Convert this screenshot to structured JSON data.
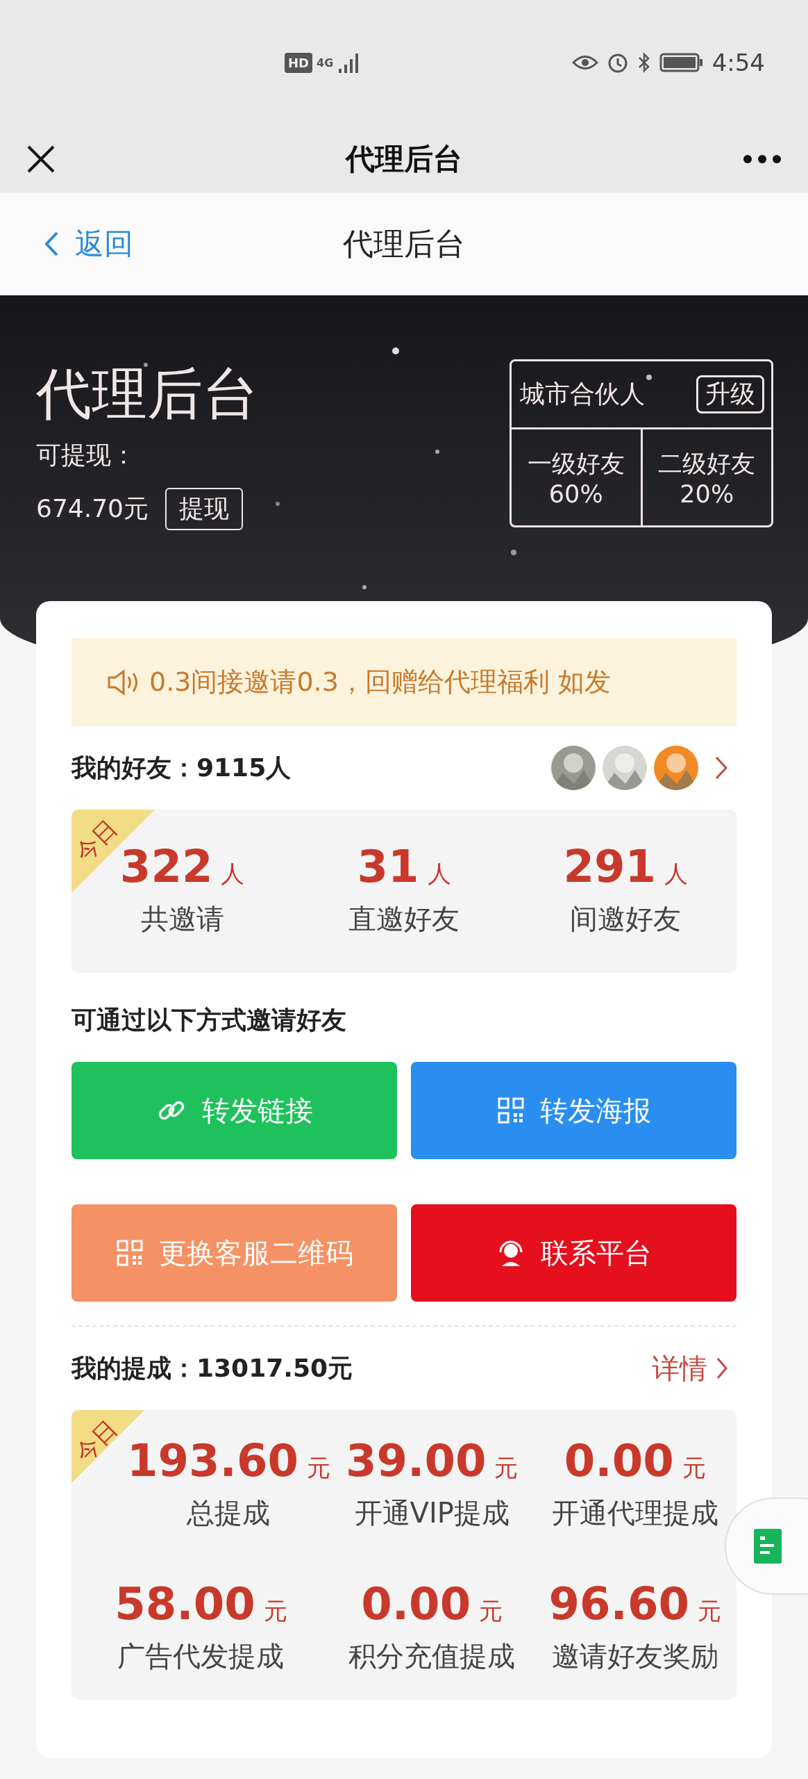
{
  "status_bar": {
    "hd_badge": "HD",
    "network": "4G",
    "time": "4:54"
  },
  "header": {
    "title": "代理后台"
  },
  "nav": {
    "back": "返回",
    "title": "代理后台"
  },
  "hero": {
    "title": "代理后台",
    "balance_label": "可提现：",
    "balance": "674.70元",
    "withdraw_button": "提现",
    "level": {
      "name": "城市合伙人",
      "upgrade_button": "升级",
      "tiers": [
        {
          "label": "一级好友",
          "rate": "60%"
        },
        {
          "label": "二级好友",
          "rate": "20%"
        }
      ]
    }
  },
  "notice": {
    "text": "0.3间接邀请0.3，回赠给代理福利 如发"
  },
  "friends": {
    "title": "我的好友：9115人"
  },
  "friend_stats": {
    "ribbon": "今日",
    "items": [
      {
        "value": "322",
        "unit": "人",
        "label": "共邀请"
      },
      {
        "value": "31",
        "unit": "人",
        "label": "直邀好友"
      },
      {
        "value": "291",
        "unit": "人",
        "label": "间邀好友"
      }
    ]
  },
  "invite": {
    "title": "可通过以下方式邀请好友",
    "buttons": [
      {
        "label": "转发链接",
        "kind": "link"
      },
      {
        "label": "转发海报",
        "kind": "poster"
      },
      {
        "label": "更换客服二维码",
        "kind": "qrcode"
      },
      {
        "label": "联系平台",
        "kind": "contact"
      }
    ]
  },
  "commission": {
    "title": "我的提成：13017.50元",
    "details_link": "详情",
    "ribbon": "今日",
    "items": [
      {
        "value": "193.60",
        "unit": "元",
        "label": "总提成"
      },
      {
        "value": "39.00",
        "unit": "元",
        "label": "开通VIP提成"
      },
      {
        "value": "0.00",
        "unit": "元",
        "label": "开通代理提成"
      },
      {
        "value": "58.00",
        "unit": "元",
        "label": "广告代发提成"
      },
      {
        "value": "0.00",
        "unit": "元",
        "label": "积分充值提成"
      },
      {
        "value": "96.60",
        "unit": "元",
        "label": "邀请好友奖励"
      }
    ]
  }
}
